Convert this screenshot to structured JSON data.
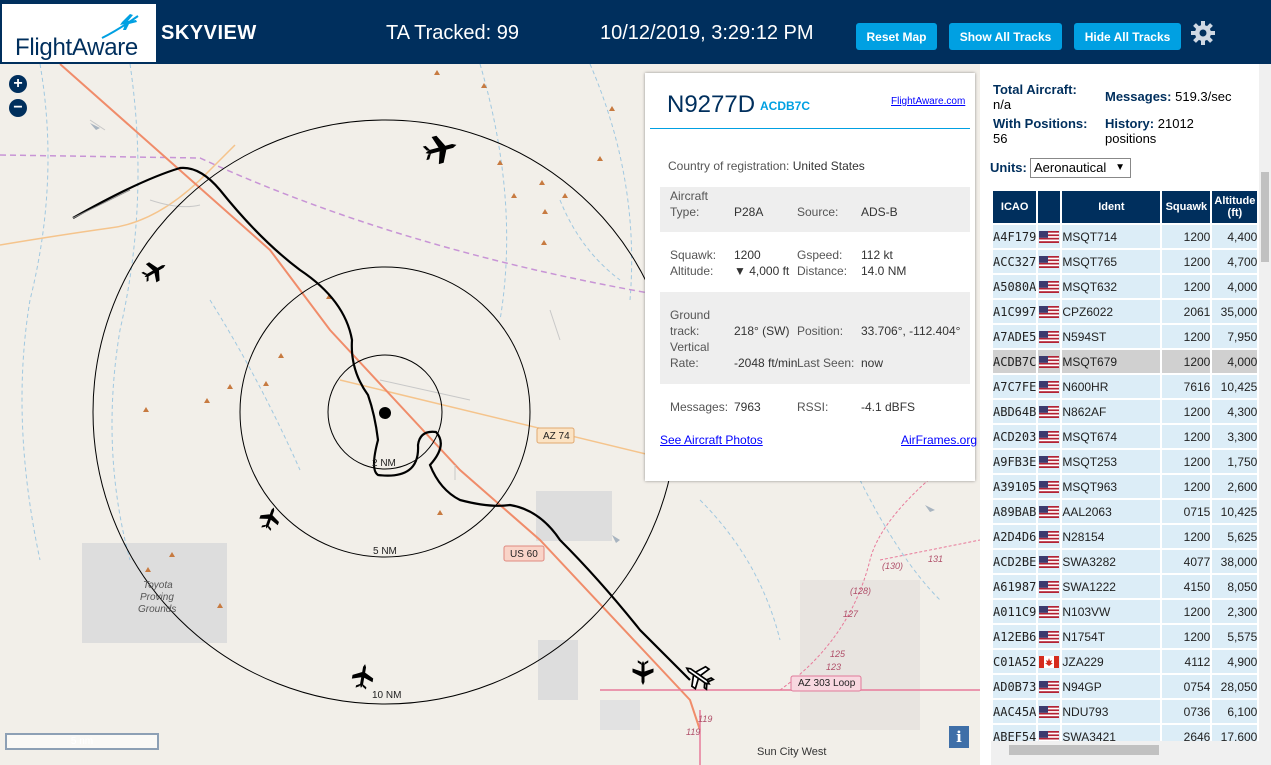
{
  "header": {
    "logo_text": "FlightAware",
    "brand": "SKYVIEW",
    "tracked": "TA Tracked: 99",
    "datetime": "10/12/2019, 3:29:12 PM",
    "buttons": {
      "reset": "Reset Map",
      "show": "Show All Tracks",
      "hide": "Hide All Tracks"
    },
    "colors": {
      "navy": "#002f5d",
      "accent": "#00a0e2"
    }
  },
  "map": {
    "zoom_in": "+",
    "zoom_out": "−",
    "scale_label": "5 nm",
    "info": "i",
    "range_rings": [
      "2 NM",
      "5 NM",
      "10 NM"
    ],
    "labels": {
      "az74": "AZ 74",
      "us60": "US 60",
      "az303": "AZ 303 Loop",
      "toyota": "Toyota",
      "proving": "Proving",
      "grounds": "Grounds",
      "sun_city": "Sun City West",
      "r128": "(128)",
      "r127": "127",
      "r130": "(130)",
      "r131": "131",
      "r125": "125",
      "r123": "123",
      "r119a": "119",
      "r119b": "119"
    }
  },
  "popup": {
    "registration": "N9277D",
    "icao": "ACDB7C",
    "fa_link": "FlightAware.com",
    "country_label": "Country of registration:",
    "country": "United States",
    "aircraft_type_label_1": "Aircraft",
    "aircraft_type_label_2": "Type:",
    "aircraft_type": "P28A",
    "source_label": "Source:",
    "source": "ADS-B",
    "squawk_label": "Squawk:",
    "squawk": "1200",
    "gspeed_label": "Gspeed:",
    "gspeed": "112 kt",
    "altitude_label": "Altitude:",
    "altitude": "▼ 4,000 ft",
    "distance_label": "Distance:",
    "distance": "14.0 NM",
    "ground_label_1": "Ground",
    "ground_label_2": "track:",
    "ground_track": "218° (SW)",
    "position_label": "Position:",
    "position": "33.706°, -112.404°",
    "vrate_label_1": "Vertical",
    "vrate_label_2": "Rate:",
    "vrate": "-2048 ft/min",
    "last_seen_label": "Last Seen:",
    "last_seen": "now",
    "messages_label": "Messages:",
    "messages": "7963",
    "rssi_label": "RSSI:",
    "rssi": "-4.1 dBFS",
    "photos_link": "See Aircraft Photos",
    "airframes_link": "AirFrames.org"
  },
  "panel": {
    "total_label": "Total Aircraft:",
    "total_value": "n/a",
    "messages_label": "Messages:",
    "messages_value": "519.3/sec",
    "positions_label": "With Positions:",
    "positions_value": "56",
    "history_label": "History:",
    "history_value": "21012",
    "history_unit": "positions",
    "units_label": "Units:",
    "units_value": "Aeronautical",
    "columns": {
      "icao": "ICAO",
      "ident": "Ident",
      "squawk": "Squawk",
      "altitude_1": "Altitude",
      "altitude_2": "(ft)"
    },
    "rows": [
      {
        "icao": "A4F179",
        "country": "us",
        "ident": "MSQT714",
        "squawk": "1200",
        "alt": "4,400"
      },
      {
        "icao": "ACC327",
        "country": "us",
        "ident": "MSQT765",
        "squawk": "1200",
        "alt": "4,700"
      },
      {
        "icao": "A5080A",
        "country": "us",
        "ident": "MSQT632",
        "squawk": "1200",
        "alt": "4,000"
      },
      {
        "icao": "A1C997",
        "country": "us",
        "ident": "CPZ6022",
        "squawk": "2061",
        "alt": "35,000"
      },
      {
        "icao": "A7ADE5",
        "country": "us",
        "ident": "N594ST",
        "squawk": "1200",
        "alt": "7,950"
      },
      {
        "icao": "ACDB7C",
        "country": "us",
        "ident": "MSQT679",
        "squawk": "1200",
        "alt": "4,000",
        "selected": true
      },
      {
        "icao": "A7C7FE",
        "country": "us",
        "ident": "N600HR",
        "squawk": "7616",
        "alt": "10,425"
      },
      {
        "icao": "ABD64B",
        "country": "us",
        "ident": "N862AF",
        "squawk": "1200",
        "alt": "4,300"
      },
      {
        "icao": "ACD203",
        "country": "us",
        "ident": "MSQT674",
        "squawk": "1200",
        "alt": "3,300"
      },
      {
        "icao": "A9FB3E",
        "country": "us",
        "ident": "MSQT253",
        "squawk": "1200",
        "alt": "1,750"
      },
      {
        "icao": "A39105",
        "country": "us",
        "ident": "MSQT963",
        "squawk": "1200",
        "alt": "2,600"
      },
      {
        "icao": "A89BAB",
        "country": "us",
        "ident": "AAL2063",
        "squawk": "0715",
        "alt": "10,425"
      },
      {
        "icao": "A2D4D6",
        "country": "us",
        "ident": "N28154",
        "squawk": "1200",
        "alt": "5,625"
      },
      {
        "icao": "ACD2BE",
        "country": "us",
        "ident": "SWA3282",
        "squawk": "4077",
        "alt": "38,000"
      },
      {
        "icao": "A61987",
        "country": "us",
        "ident": "SWA1222",
        "squawk": "4150",
        "alt": "8,050"
      },
      {
        "icao": "A011C9",
        "country": "us",
        "ident": "N103VW",
        "squawk": "1200",
        "alt": "2,300"
      },
      {
        "icao": "A12EB6",
        "country": "us",
        "ident": "N1754T",
        "squawk": "1200",
        "alt": "5,575"
      },
      {
        "icao": "C01A52",
        "country": "ca",
        "ident": "JZA229",
        "squawk": "4112",
        "alt": "4,900"
      },
      {
        "icao": "AD0B73",
        "country": "us",
        "ident": "N94GP",
        "squawk": "0754",
        "alt": "28,050"
      },
      {
        "icao": "AAC45A",
        "country": "us",
        "ident": "NDU793",
        "squawk": "0736",
        "alt": "6,100"
      },
      {
        "icao": "ABEF54",
        "country": "us",
        "ident": "SWA3421",
        "squawk": "2646",
        "alt": "17,600"
      }
    ]
  }
}
